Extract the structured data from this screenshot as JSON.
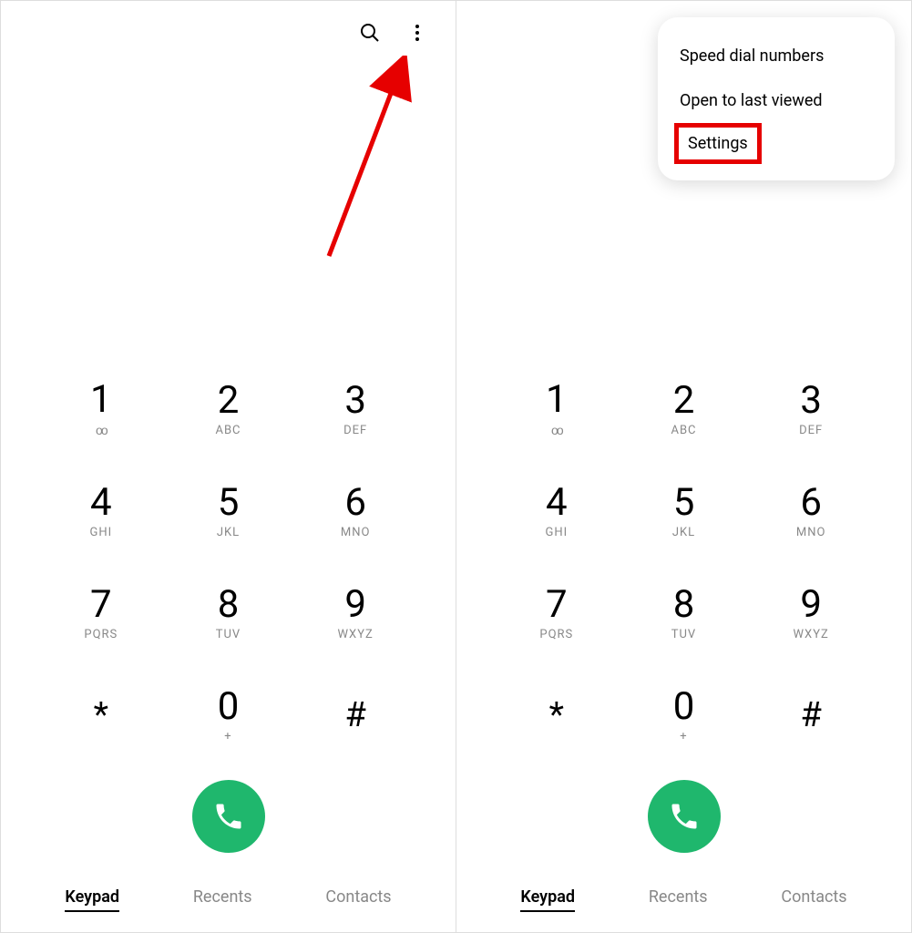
{
  "keypad": {
    "keys": [
      {
        "digit": "1",
        "letters": "ᴏᴏ"
      },
      {
        "digit": "2",
        "letters": "ABC"
      },
      {
        "digit": "3",
        "letters": "DEF"
      },
      {
        "digit": "4",
        "letters": "GHI"
      },
      {
        "digit": "5",
        "letters": "JKL"
      },
      {
        "digit": "6",
        "letters": "MNO"
      },
      {
        "digit": "7",
        "letters": "PQRS"
      },
      {
        "digit": "8",
        "letters": "TUV"
      },
      {
        "digit": "9",
        "letters": "WXYZ"
      },
      {
        "digit": "*",
        "letters": ""
      },
      {
        "digit": "0",
        "letters": "+"
      },
      {
        "digit": "#",
        "letters": ""
      }
    ]
  },
  "nav": {
    "keypad": "Keypad",
    "recents": "Recents",
    "contacts": "Contacts"
  },
  "menu": {
    "speed_dial": "Speed dial numbers",
    "open_last": "Open to last viewed",
    "settings": "Settings"
  },
  "colors": {
    "call_button": "#1fb76d",
    "annotation": "#e60000"
  }
}
